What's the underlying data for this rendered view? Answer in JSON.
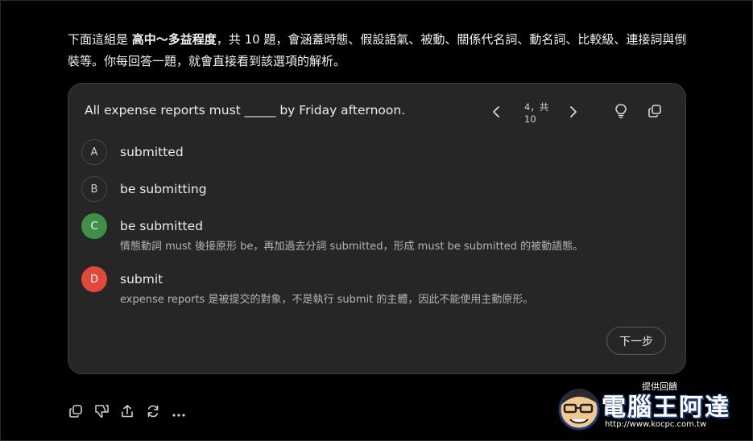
{
  "intro": {
    "part1": "下面這組是 ",
    "bold": "高中～多益程度",
    "part2": "，共 10 題，會涵蓋時態、假設語氣、被動、關係代名詞、動名詞、比較級、連接詞與倒裝等。你每回答一題，就會直接看到該選項的解析。"
  },
  "quiz": {
    "question": "All expense reports must _____ by Friday afternoon.",
    "counter": "4，共 10",
    "options": [
      {
        "letter": "A",
        "text": "submitted",
        "state": "neutral",
        "explanation": ""
      },
      {
        "letter": "B",
        "text": "be submitting",
        "state": "neutral",
        "explanation": ""
      },
      {
        "letter": "C",
        "text": "be submitted",
        "state": "correct",
        "explanation": "情態動詞 must 後接原形 be，再加過去分詞 submitted，形成 must be submitted 的被動語態。"
      },
      {
        "letter": "D",
        "text": "submit",
        "state": "wrong",
        "explanation": "expense reports 是被提交的對象，不是執行 submit 的主體，因此不能使用主動原形。"
      }
    ],
    "next_label": "下一步"
  },
  "footer": {
    "feedback_label": "提供回饋"
  },
  "watermark": {
    "text": "電腦王阿達",
    "url": "http://www.kocpc.com.tw"
  },
  "colors": {
    "correct": "#3f8f46",
    "wrong": "#e0493b",
    "card_bg": "#262626"
  },
  "icons": [
    "chevron-left-icon",
    "chevron-right-icon",
    "lightbulb-icon",
    "copy-icon",
    "thumbs-down-icon",
    "share-icon",
    "regenerate-icon",
    "more-icon"
  ]
}
